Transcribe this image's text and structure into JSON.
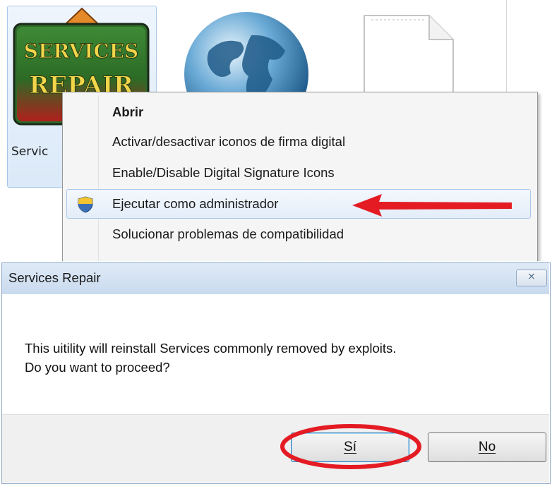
{
  "explorer": {
    "icon_label": "Servic",
    "app_icon_text": [
      "SERVICES",
      "REPAIR"
    ]
  },
  "context_menu": {
    "items": [
      {
        "label": "Abrir"
      },
      {
        "label": "Activar/desactivar iconos de firma digital"
      },
      {
        "label": "Enable/Disable Digital Signature Icons"
      },
      {
        "label": "Ejecutar como administrador",
        "icon": "uac-shield-icon",
        "highlighted": true
      },
      {
        "label": "Solucionar problemas de compatibilidad"
      }
    ]
  },
  "dialog": {
    "title": "Services Repair",
    "close_label": "⨯",
    "message_lines": [
      "This uitility will reinstall Services commonly removed by exploits.",
      "Do you want to proceed?"
    ],
    "buttons": {
      "yes": "Sí",
      "no": "No"
    }
  },
  "colors": {
    "annotation_red": "#e41b23",
    "selection_border": "#aac8ea",
    "dialog_title_bg": "#c9daee"
  }
}
